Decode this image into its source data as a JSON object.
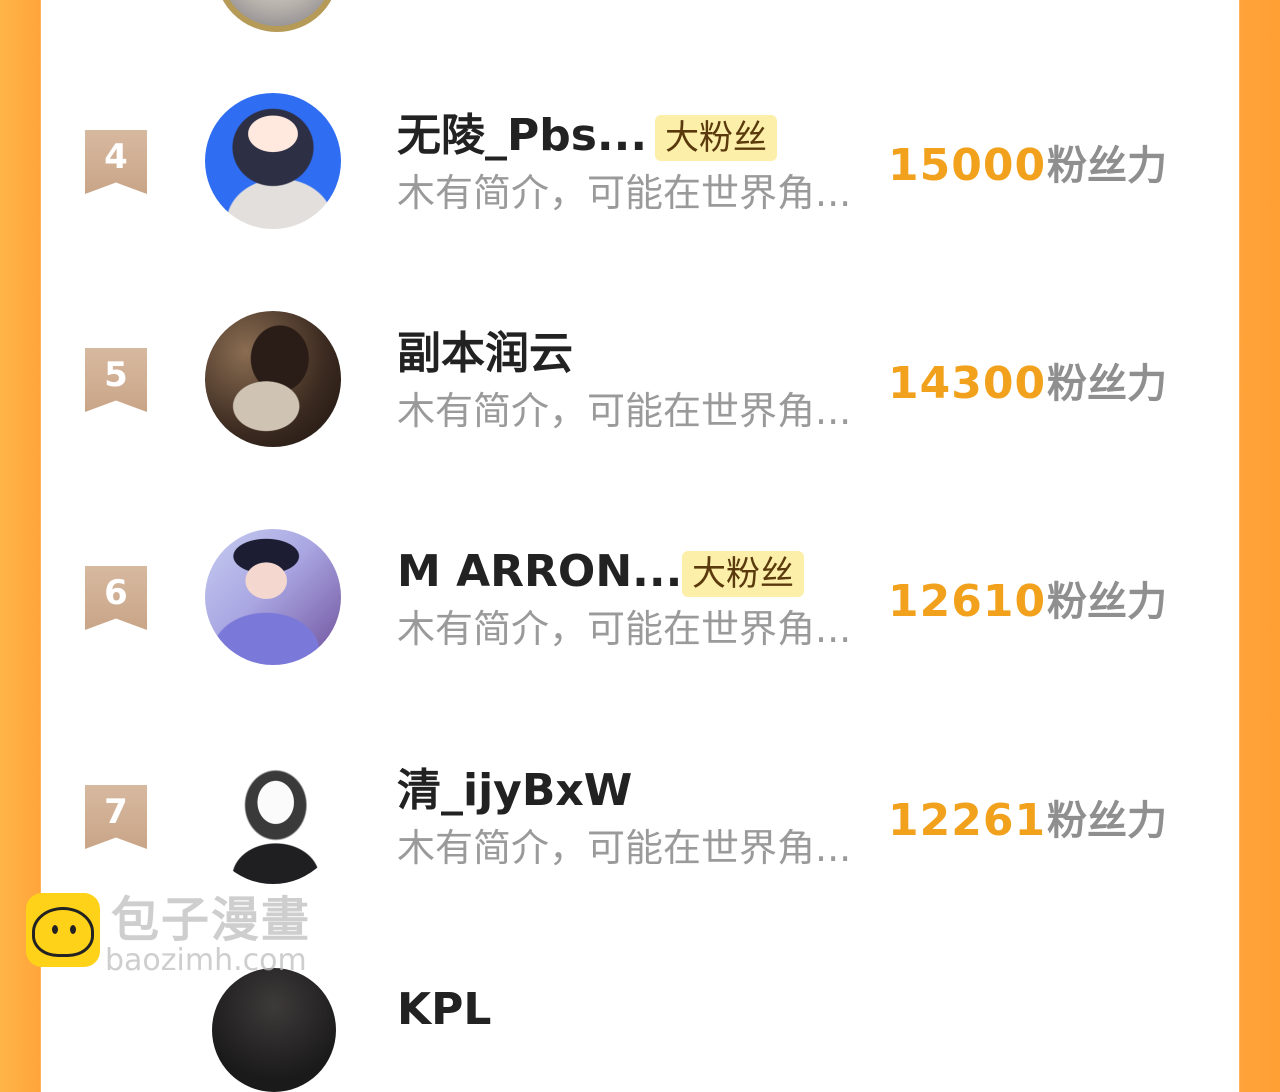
{
  "top_partial": {
    "avatar_icon": "user-avatar-icon"
  },
  "rows": [
    {
      "rank": "4",
      "name": "无陵_Pbs...",
      "tag": "大粉丝",
      "desc": "木有简介，可能在世界角...",
      "score": "15000",
      "unit": "粉丝力"
    },
    {
      "rank": "5",
      "name": "副本润云",
      "tag": "",
      "desc": "木有简介，可能在世界角...",
      "score": "14300",
      "unit": "粉丝力"
    },
    {
      "rank": "6",
      "name": "M ARRON...",
      "tag": "大粉丝",
      "desc": "木有简介，可能在世界角...",
      "score": "12610",
      "unit": "粉丝力"
    },
    {
      "rank": "7",
      "name": "清_ijyBxW",
      "tag": "",
      "desc": "木有简介，可能在世界角...",
      "score": "12261",
      "unit": "粉丝力"
    }
  ],
  "bottom_partial": {
    "name": "KPL"
  },
  "watermark": {
    "title": "包子漫畫",
    "url": "baozimh.com"
  },
  "colors": {
    "side_orange": "#ffa43a",
    "score_orange": "#f2a11c",
    "badge_tan": "#c9a587",
    "tag_yellow": "#fcefa9"
  }
}
